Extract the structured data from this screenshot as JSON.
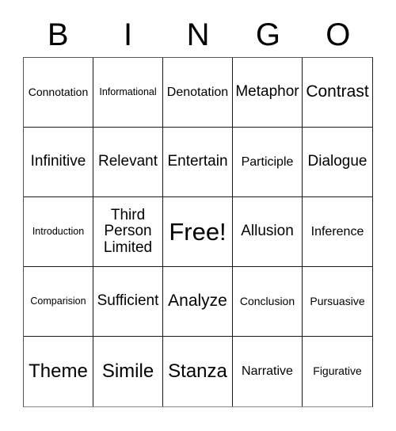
{
  "card": {
    "type": "bingo-card",
    "background_color": "#ffffff",
    "text_color": "#000000",
    "border_color": "#1a1a1a",
    "columns": 5,
    "rows": 5,
    "header_letters": [
      "B",
      "I",
      "N",
      "G",
      "O"
    ],
    "free_space_label": "Free!",
    "free_space_position": {
      "row": 3,
      "column": 3
    },
    "cells": [
      {
        "text": "Connotation",
        "size": "fs-sm",
        "lines": 1
      },
      {
        "text": "Informational",
        "size": "fs-xs",
        "lines": 1
      },
      {
        "text": "Denotation",
        "size": "fs-md",
        "lines": 1
      },
      {
        "text": "Metaphor",
        "size": "fs-lg",
        "lines": 1
      },
      {
        "text": "Contrast",
        "size": "fs-xl",
        "lines": 1
      },
      {
        "text": "Infinitive",
        "size": "fs-lg",
        "lines": 1
      },
      {
        "text": "Relevant",
        "size": "fs-lg",
        "lines": 1
      },
      {
        "text": "Entertain",
        "size": "fs-lg",
        "lines": 1
      },
      {
        "text": "Participle",
        "size": "fs-md",
        "lines": 1
      },
      {
        "text": "Dialogue",
        "size": "fs-lg",
        "lines": 1
      },
      {
        "text": "Introduction",
        "size": "fs-xs",
        "lines": 1
      },
      {
        "text": "Third\nPerson\nLimited",
        "size": "fs-lg",
        "lines": 3
      },
      {
        "text": "Free!",
        "size": "fs-free",
        "lines": 1
      },
      {
        "text": "Allusion",
        "size": "fs-lg",
        "lines": 1
      },
      {
        "text": "Inference",
        "size": "fs-md",
        "lines": 1
      },
      {
        "text": "Comparision",
        "size": "fs-xs",
        "lines": 1
      },
      {
        "text": "Sufficient",
        "size": "fs-lg",
        "lines": 1
      },
      {
        "text": "Analyze",
        "size": "fs-xl",
        "lines": 1
      },
      {
        "text": "Conclusion",
        "size": "fs-sm",
        "lines": 1
      },
      {
        "text": "Pursuasive",
        "size": "fs-sm",
        "lines": 1
      },
      {
        "text": "Theme",
        "size": "fs-xxl",
        "lines": 1
      },
      {
        "text": "Simile",
        "size": "fs-xxl",
        "lines": 1
      },
      {
        "text": "Stanza",
        "size": "fs-xxl",
        "lines": 1
      },
      {
        "text": "Narrative",
        "size": "fs-md",
        "lines": 1
      },
      {
        "text": "Figurative",
        "size": "fs-sm",
        "lines": 1
      }
    ]
  }
}
